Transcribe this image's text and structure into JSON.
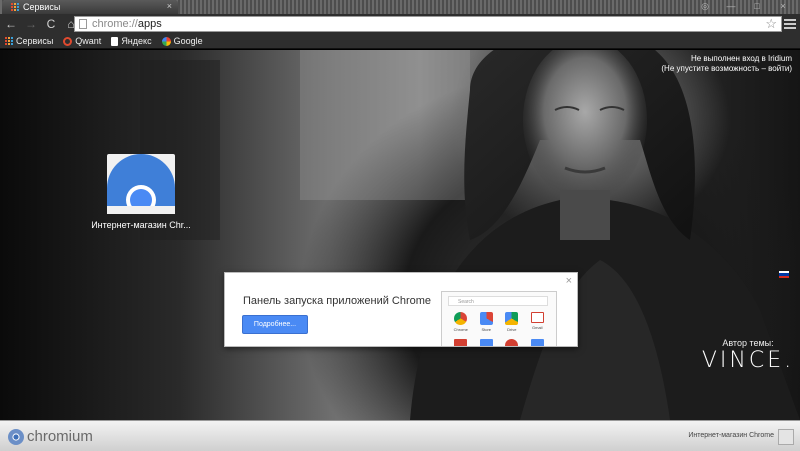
{
  "tab": {
    "title": "Сервисы",
    "close": "×"
  },
  "window_controls": {
    "minimize": "—",
    "maximize": "□",
    "close": "×",
    "user": "◎"
  },
  "toolbar": {
    "back": "←",
    "forward": "→",
    "reload": "C",
    "home": "⌂"
  },
  "omnibox": {
    "scheme": "chrome://",
    "path": "apps",
    "star": "☆"
  },
  "bookmarks": [
    {
      "label": "Сервисы",
      "icon": "apps-grid-icon"
    },
    {
      "label": "Qwant",
      "icon": "qwant-icon",
      "color": "#e04a2f"
    },
    {
      "label": "Яндекс",
      "icon": "yandex-icon",
      "color": "#ffffff"
    },
    {
      "label": "Google",
      "icon": "google-icon",
      "color": "#4285f4"
    }
  ],
  "signin": {
    "line1": "Не выполнен вход в Iridium",
    "line2": "(Не упустите возможность – войти)"
  },
  "app": {
    "label": "Интернет-магазин Chr..."
  },
  "theme": {
    "author_label": "Автор темы:",
    "author_name": "VINCE."
  },
  "promo": {
    "title": "Панель запуска приложений Chrome",
    "button": "Подробнее...",
    "close": "×",
    "preview": {
      "search_placeholder": "Search",
      "apps": [
        {
          "label": "Chrome",
          "color": "#db4437"
        },
        {
          "label": "Store",
          "color": "#4a8af4"
        },
        {
          "label": "Drive",
          "color": "#0f9d58"
        },
        {
          "label": "Gmail",
          "color": "#d23f31"
        },
        {
          "label": "",
          "color": "#d23f31"
        },
        {
          "label": "",
          "color": "#4a8af4"
        },
        {
          "label": "",
          "color": "#d23f31"
        },
        {
          "label": "",
          "color": "#4a8af4"
        }
      ]
    }
  },
  "shelf": {
    "brand": "chromium",
    "item_label": "Интернет-магазин Chrome"
  },
  "colors": {
    "accent": "#4a8af4",
    "flag": [
      "#ffffff",
      "#0039a6",
      "#d52b1e"
    ]
  }
}
